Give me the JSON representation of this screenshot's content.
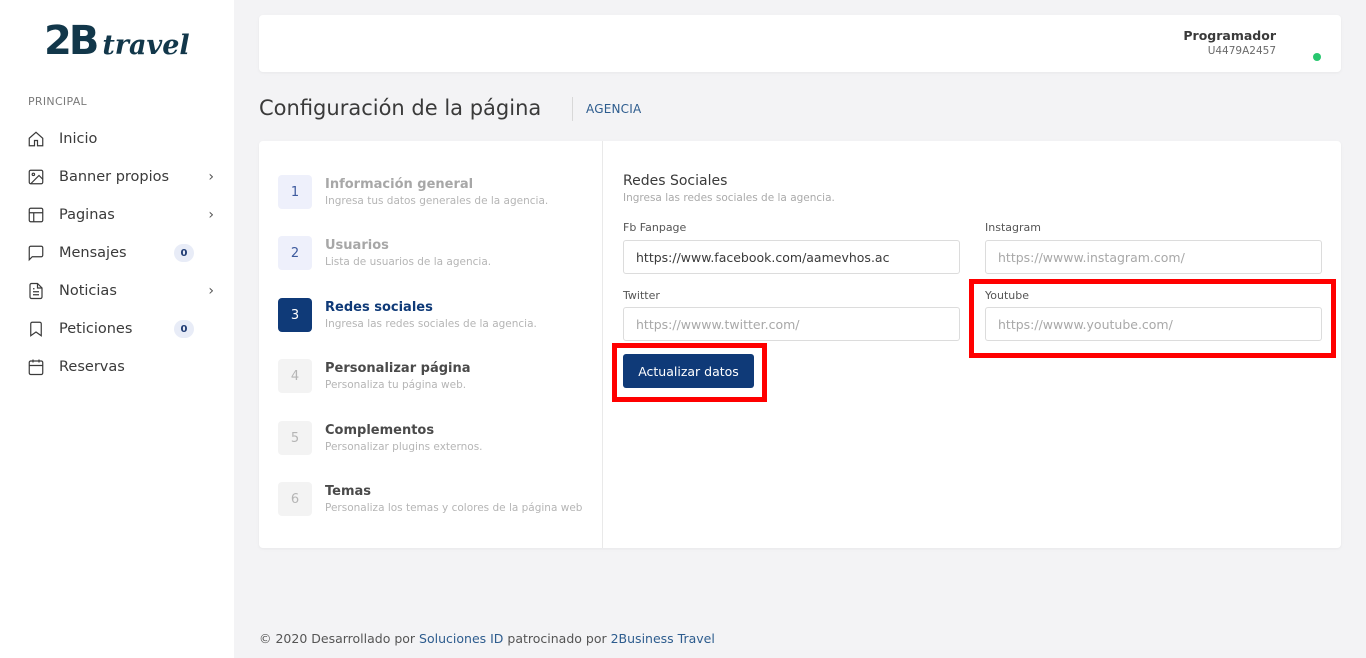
{
  "brand": {
    "logo_main": "2B",
    "logo_sub": "travel"
  },
  "sidebar": {
    "section": "PRINCIPAL",
    "items": [
      {
        "label": "Inicio",
        "icon": "home-icon"
      },
      {
        "label": "Banner propios",
        "icon": "image-icon",
        "chevron": "›"
      },
      {
        "label": "Paginas",
        "icon": "layout-icon",
        "chevron": "›"
      },
      {
        "label": "Mensajes",
        "icon": "message-icon",
        "badge": "0"
      },
      {
        "label": "Noticias",
        "icon": "document-icon",
        "chevron": "›"
      },
      {
        "label": "Peticiones",
        "icon": "bookmark-icon",
        "badge": "0"
      },
      {
        "label": "Reservas",
        "icon": "calendar-icon"
      }
    ]
  },
  "user": {
    "name": "Programador",
    "code": "U4479A2457",
    "status_color": "#28c76f"
  },
  "page": {
    "title": "Configuración de la página",
    "breadcrumb": "AGENCIA"
  },
  "steps": [
    {
      "num": "1",
      "title": "Información general",
      "desc": "Ingresa tus datos generales de la agencia."
    },
    {
      "num": "2",
      "title": "Usuarios",
      "desc": "Lista de usuarios de la agencia."
    },
    {
      "num": "3",
      "title": "Redes sociales",
      "desc": "Ingresa las redes sociales de la agencia."
    },
    {
      "num": "4",
      "title": "Personalizar página",
      "desc": "Personaliza tu página web."
    },
    {
      "num": "5",
      "title": "Complementos",
      "desc": "Personalizar plugins externos."
    },
    {
      "num": "6",
      "title": "Temas",
      "desc": "Personaliza los temas y colores de la página web"
    }
  ],
  "form": {
    "title": "Redes Sociales",
    "subtitle": "Ingresa las redes sociales de la agencia.",
    "fb": {
      "label": "Fb Fanpage",
      "value": "https://www.facebook.com/aamevhos.ac",
      "placeholder": ""
    },
    "instagram": {
      "label": "Instagram",
      "value": "",
      "placeholder": "https://wwww.instagram.com/"
    },
    "twitter": {
      "label": "Twitter",
      "value": "",
      "placeholder": "https://wwww.twitter.com/"
    },
    "youtube": {
      "label": "Youtube",
      "value": "",
      "placeholder": "https://wwww.youtube.com/"
    },
    "submit_label": "Actualizar datos"
  },
  "footer": {
    "prefix": "© 2020 Desarrollado por ",
    "link1": "Soluciones ID",
    "middle": " patrocinado por ",
    "link2": "2Business Travel"
  },
  "colors": {
    "primary": "#0f3a78",
    "highlight": "#ff0000",
    "link": "#2d5c8e"
  }
}
